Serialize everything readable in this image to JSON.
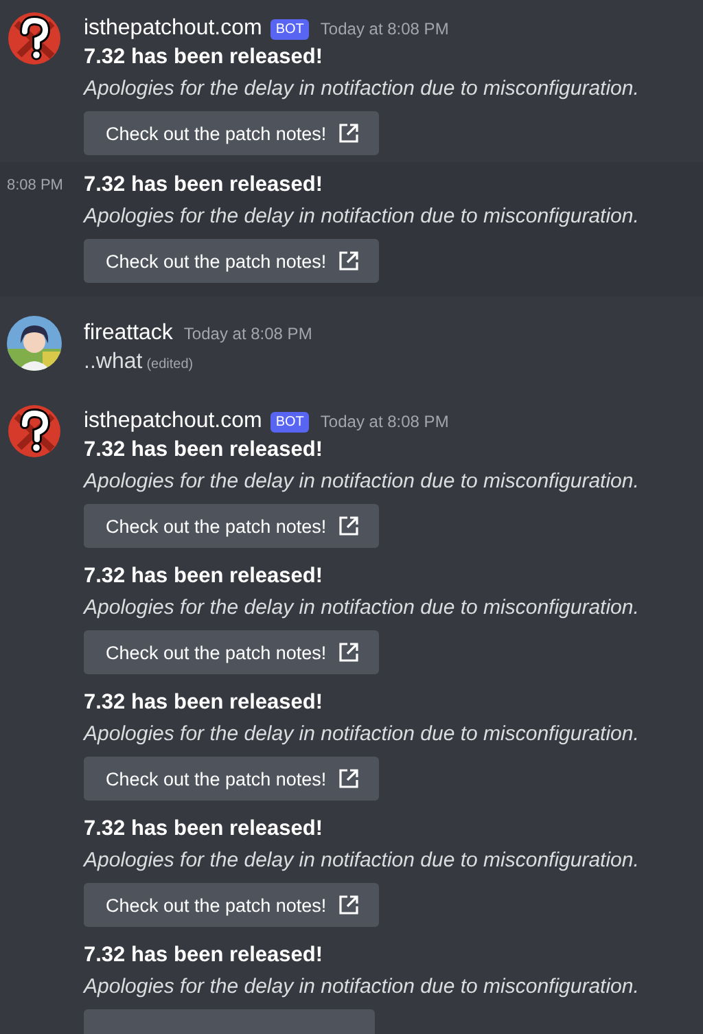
{
  "messages": [
    {
      "kind": "group",
      "highlighted": false,
      "avatar": {
        "kind": "bot"
      },
      "author": "isthepatchout.com",
      "tag": "BOT",
      "timestamp": "Today at 8:08 PM",
      "embeds": [
        {
          "kind": "full",
          "title": "7.32 has been released!",
          "description": "Apologies for the delay in notifaction due to misconfiguration.",
          "button": "Check out the patch notes!"
        }
      ]
    },
    {
      "kind": "continuation",
      "highlighted": true,
      "timestamp": "8:08 PM",
      "embeds": [
        {
          "kind": "full",
          "title": "7.32 has been released!",
          "description": "Apologies for the delay in notifaction due to misconfiguration.",
          "button": "Check out the patch notes!"
        }
      ]
    },
    {
      "kind": "group",
      "highlighted": false,
      "avatar": {
        "kind": "user"
      },
      "author": "fireattack",
      "timestamp": "Today at 8:08 PM",
      "text": "..what",
      "edited": "(edited)"
    },
    {
      "kind": "group",
      "highlighted": false,
      "avatar": {
        "kind": "bot"
      },
      "author": "isthepatchout.com",
      "tag": "BOT",
      "timestamp": "Today at 8:08 PM",
      "embeds": [
        {
          "kind": "full",
          "title": "7.32 has been released!",
          "description": "Apologies for the delay in notifaction due to misconfiguration.",
          "button": "Check out the patch notes!"
        },
        {
          "kind": "full",
          "title": "7.32 has been released!",
          "description": "Apologies for the delay in notifaction due to misconfiguration.",
          "button": "Check out the patch notes!"
        },
        {
          "kind": "full",
          "title": "7.32 has been released!",
          "description": "Apologies for the delay in notifaction due to misconfiguration.",
          "button": "Check out the patch notes!"
        },
        {
          "kind": "full",
          "title": "7.32 has been released!",
          "description": "Apologies for the delay in notifaction due to misconfiguration.",
          "button": "Check out the patch notes!"
        },
        {
          "kind": "cut",
          "title": "7.32 has been released!",
          "description": "Apologies for the delay in notifaction due to misconfiguration."
        }
      ]
    }
  ]
}
